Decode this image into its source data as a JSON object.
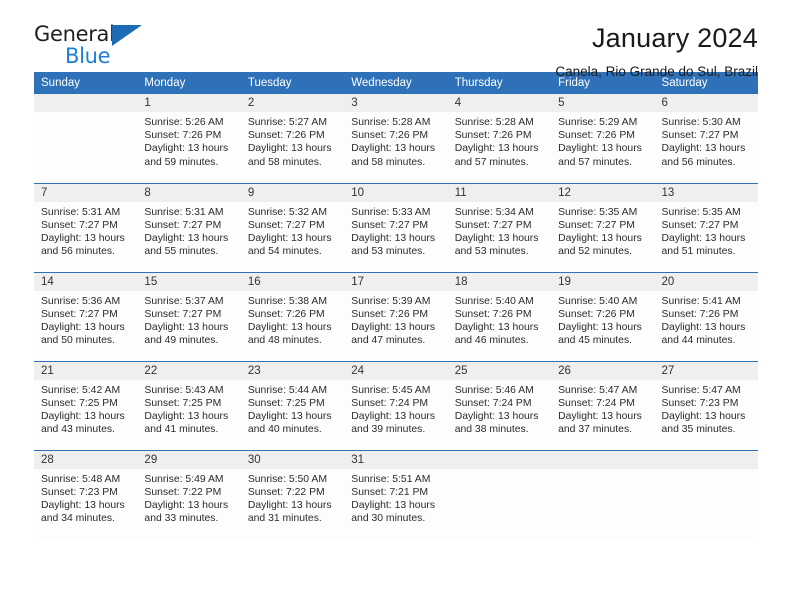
{
  "brand": {
    "name_dark": "General",
    "name_blue": "Blue",
    "triangle_icon": "blue-triangle-logo-mark",
    "accent_color": "#1b6cb3"
  },
  "header": {
    "month_title": "January 2024",
    "location": "Canela, Rio Grande do Sul, Brazil"
  },
  "colors": {
    "header_blue": "#2e71b8",
    "day_band_gray": "#efefef",
    "cell_white": "#fdfdfd",
    "text": "#2b2b2b"
  },
  "weekdays": [
    "Sunday",
    "Monday",
    "Tuesday",
    "Wednesday",
    "Thursday",
    "Friday",
    "Saturday"
  ],
  "weeks": [
    [
      {
        "day": "",
        "sunrise": "",
        "sunset": "",
        "daylight1": "",
        "daylight2": ""
      },
      {
        "day": "1",
        "sunrise": "Sunrise: 5:26 AM",
        "sunset": "Sunset: 7:26 PM",
        "daylight1": "Daylight: 13 hours",
        "daylight2": "and 59 minutes."
      },
      {
        "day": "2",
        "sunrise": "Sunrise: 5:27 AM",
        "sunset": "Sunset: 7:26 PM",
        "daylight1": "Daylight: 13 hours",
        "daylight2": "and 58 minutes."
      },
      {
        "day": "3",
        "sunrise": "Sunrise: 5:28 AM",
        "sunset": "Sunset: 7:26 PM",
        "daylight1": "Daylight: 13 hours",
        "daylight2": "and 58 minutes."
      },
      {
        "day": "4",
        "sunrise": "Sunrise: 5:28 AM",
        "sunset": "Sunset: 7:26 PM",
        "daylight1": "Daylight: 13 hours",
        "daylight2": "and 57 minutes."
      },
      {
        "day": "5",
        "sunrise": "Sunrise: 5:29 AM",
        "sunset": "Sunset: 7:26 PM",
        "daylight1": "Daylight: 13 hours",
        "daylight2": "and 57 minutes."
      },
      {
        "day": "6",
        "sunrise": "Sunrise: 5:30 AM",
        "sunset": "Sunset: 7:27 PM",
        "daylight1": "Daylight: 13 hours",
        "daylight2": "and 56 minutes."
      }
    ],
    [
      {
        "day": "7",
        "sunrise": "Sunrise: 5:31 AM",
        "sunset": "Sunset: 7:27 PM",
        "daylight1": "Daylight: 13 hours",
        "daylight2": "and 56 minutes."
      },
      {
        "day": "8",
        "sunrise": "Sunrise: 5:31 AM",
        "sunset": "Sunset: 7:27 PM",
        "daylight1": "Daylight: 13 hours",
        "daylight2": "and 55 minutes."
      },
      {
        "day": "9",
        "sunrise": "Sunrise: 5:32 AM",
        "sunset": "Sunset: 7:27 PM",
        "daylight1": "Daylight: 13 hours",
        "daylight2": "and 54 minutes."
      },
      {
        "day": "10",
        "sunrise": "Sunrise: 5:33 AM",
        "sunset": "Sunset: 7:27 PM",
        "daylight1": "Daylight: 13 hours",
        "daylight2": "and 53 minutes."
      },
      {
        "day": "11",
        "sunrise": "Sunrise: 5:34 AM",
        "sunset": "Sunset: 7:27 PM",
        "daylight1": "Daylight: 13 hours",
        "daylight2": "and 53 minutes."
      },
      {
        "day": "12",
        "sunrise": "Sunrise: 5:35 AM",
        "sunset": "Sunset: 7:27 PM",
        "daylight1": "Daylight: 13 hours",
        "daylight2": "and 52 minutes."
      },
      {
        "day": "13",
        "sunrise": "Sunrise: 5:35 AM",
        "sunset": "Sunset: 7:27 PM",
        "daylight1": "Daylight: 13 hours",
        "daylight2": "and 51 minutes."
      }
    ],
    [
      {
        "day": "14",
        "sunrise": "Sunrise: 5:36 AM",
        "sunset": "Sunset: 7:27 PM",
        "daylight1": "Daylight: 13 hours",
        "daylight2": "and 50 minutes."
      },
      {
        "day": "15",
        "sunrise": "Sunrise: 5:37 AM",
        "sunset": "Sunset: 7:27 PM",
        "daylight1": "Daylight: 13 hours",
        "daylight2": "and 49 minutes."
      },
      {
        "day": "16",
        "sunrise": "Sunrise: 5:38 AM",
        "sunset": "Sunset: 7:26 PM",
        "daylight1": "Daylight: 13 hours",
        "daylight2": "and 48 minutes."
      },
      {
        "day": "17",
        "sunrise": "Sunrise: 5:39 AM",
        "sunset": "Sunset: 7:26 PM",
        "daylight1": "Daylight: 13 hours",
        "daylight2": "and 47 minutes."
      },
      {
        "day": "18",
        "sunrise": "Sunrise: 5:40 AM",
        "sunset": "Sunset: 7:26 PM",
        "daylight1": "Daylight: 13 hours",
        "daylight2": "and 46 minutes."
      },
      {
        "day": "19",
        "sunrise": "Sunrise: 5:40 AM",
        "sunset": "Sunset: 7:26 PM",
        "daylight1": "Daylight: 13 hours",
        "daylight2": "and 45 minutes."
      },
      {
        "day": "20",
        "sunrise": "Sunrise: 5:41 AM",
        "sunset": "Sunset: 7:26 PM",
        "daylight1": "Daylight: 13 hours",
        "daylight2": "and 44 minutes."
      }
    ],
    [
      {
        "day": "21",
        "sunrise": "Sunrise: 5:42 AM",
        "sunset": "Sunset: 7:25 PM",
        "daylight1": "Daylight: 13 hours",
        "daylight2": "and 43 minutes."
      },
      {
        "day": "22",
        "sunrise": "Sunrise: 5:43 AM",
        "sunset": "Sunset: 7:25 PM",
        "daylight1": "Daylight: 13 hours",
        "daylight2": "and 41 minutes."
      },
      {
        "day": "23",
        "sunrise": "Sunrise: 5:44 AM",
        "sunset": "Sunset: 7:25 PM",
        "daylight1": "Daylight: 13 hours",
        "daylight2": "and 40 minutes."
      },
      {
        "day": "24",
        "sunrise": "Sunrise: 5:45 AM",
        "sunset": "Sunset: 7:24 PM",
        "daylight1": "Daylight: 13 hours",
        "daylight2": "and 39 minutes."
      },
      {
        "day": "25",
        "sunrise": "Sunrise: 5:46 AM",
        "sunset": "Sunset: 7:24 PM",
        "daylight1": "Daylight: 13 hours",
        "daylight2": "and 38 minutes."
      },
      {
        "day": "26",
        "sunrise": "Sunrise: 5:47 AM",
        "sunset": "Sunset: 7:24 PM",
        "daylight1": "Daylight: 13 hours",
        "daylight2": "and 37 minutes."
      },
      {
        "day": "27",
        "sunrise": "Sunrise: 5:47 AM",
        "sunset": "Sunset: 7:23 PM",
        "daylight1": "Daylight: 13 hours",
        "daylight2": "and 35 minutes."
      }
    ],
    [
      {
        "day": "28",
        "sunrise": "Sunrise: 5:48 AM",
        "sunset": "Sunset: 7:23 PM",
        "daylight1": "Daylight: 13 hours",
        "daylight2": "and 34 minutes."
      },
      {
        "day": "29",
        "sunrise": "Sunrise: 5:49 AM",
        "sunset": "Sunset: 7:22 PM",
        "daylight1": "Daylight: 13 hours",
        "daylight2": "and 33 minutes."
      },
      {
        "day": "30",
        "sunrise": "Sunrise: 5:50 AM",
        "sunset": "Sunset: 7:22 PM",
        "daylight1": "Daylight: 13 hours",
        "daylight2": "and 31 minutes."
      },
      {
        "day": "31",
        "sunrise": "Sunrise: 5:51 AM",
        "sunset": "Sunset: 7:21 PM",
        "daylight1": "Daylight: 13 hours",
        "daylight2": "and 30 minutes."
      },
      {
        "day": "",
        "sunrise": "",
        "sunset": "",
        "daylight1": "",
        "daylight2": ""
      },
      {
        "day": "",
        "sunrise": "",
        "sunset": "",
        "daylight1": "",
        "daylight2": ""
      },
      {
        "day": "",
        "sunrise": "",
        "sunset": "",
        "daylight1": "",
        "daylight2": ""
      }
    ]
  ]
}
